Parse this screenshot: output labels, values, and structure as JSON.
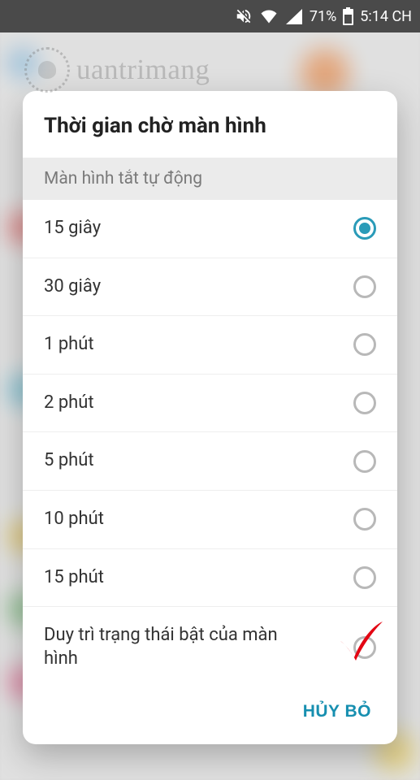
{
  "statusbar": {
    "battery_pct": "71%",
    "time": "5:14 CH"
  },
  "watermark": {
    "text": "uantrimang"
  },
  "dialog": {
    "title": "Thời gian chờ màn hình",
    "section_header": "Màn hình tắt tự động",
    "options": [
      {
        "label": "15 giây",
        "selected": true
      },
      {
        "label": "30 giây",
        "selected": false
      },
      {
        "label": "1 phút",
        "selected": false
      },
      {
        "label": "2 phút",
        "selected": false
      },
      {
        "label": "5 phút",
        "selected": false
      },
      {
        "label": "10 phút",
        "selected": false
      },
      {
        "label": "15 phút",
        "selected": false
      },
      {
        "label": "Duy trì trạng thái bật của màn hình",
        "selected": false
      }
    ],
    "cancel_label": "HỦY BỎ"
  },
  "icons": {
    "mute": "mute-icon",
    "wifi": "wifi-icon",
    "signal": "signal-icon",
    "battery": "battery-icon"
  },
  "colors": {
    "accent": "#2a9bb8",
    "cancel": "#178fb0",
    "check_annotation": "#e30613"
  }
}
